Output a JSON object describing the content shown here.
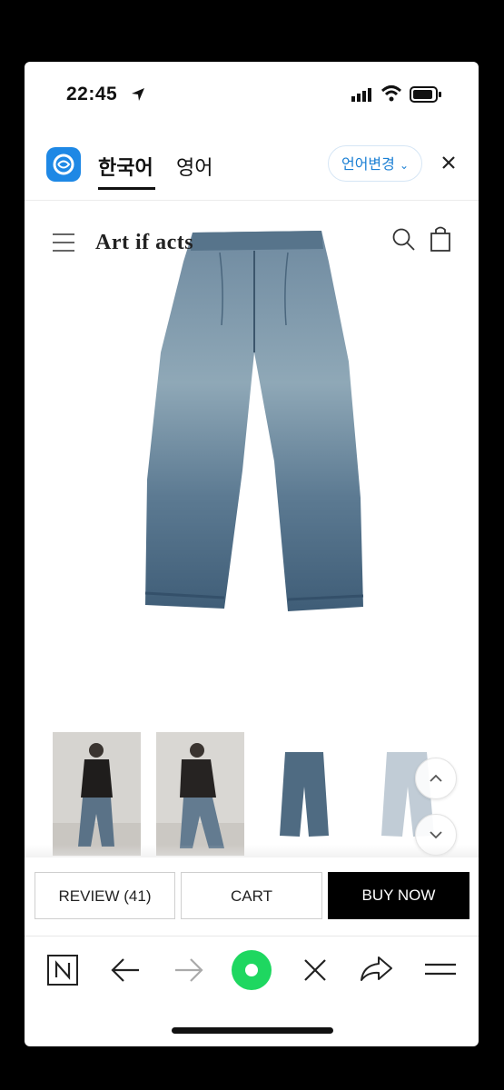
{
  "status_bar": {
    "time": "22:45"
  },
  "translate_bar": {
    "tab_korean": "한국어",
    "tab_english": "영어",
    "change_language": "언어변경"
  },
  "site": {
    "logo": "Art if acts"
  },
  "product": {
    "thumbnail_count": 4
  },
  "actions": {
    "review": "REVIEW (41)",
    "cart": "CART",
    "buy_now": "BUY NOW"
  },
  "colors": {
    "papago_blue": "#1e88e5",
    "green_button": "#1ed760",
    "link_blue": "#1a7fd4"
  },
  "browser_icons": [
    "n-icon",
    "back-arrow-icon",
    "forward-arrow-icon",
    "green-circle-icon",
    "close-icon",
    "share-icon",
    "menu-icon"
  ]
}
